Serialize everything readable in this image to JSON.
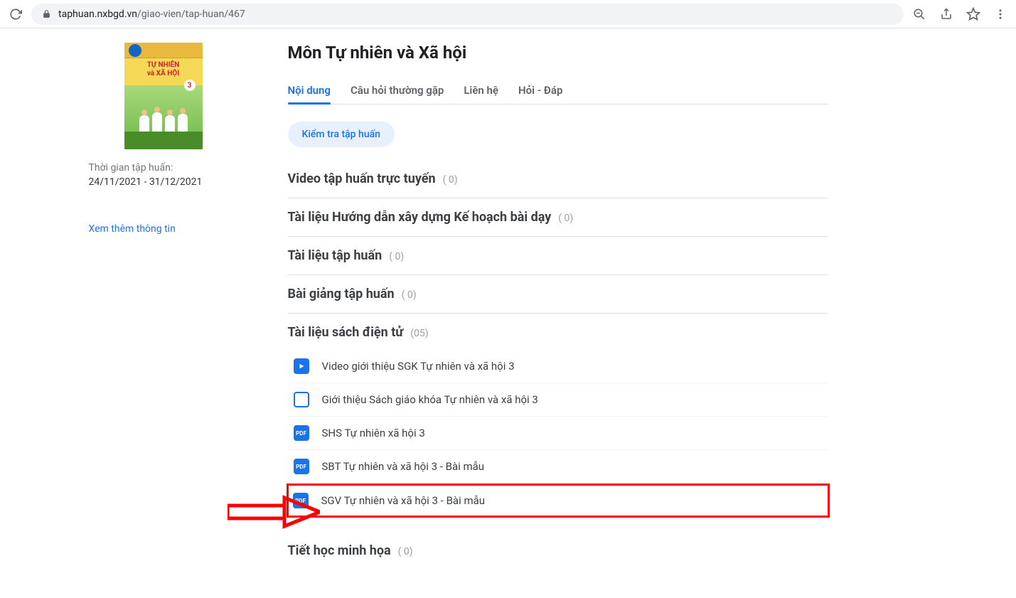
{
  "browser": {
    "url_domain": "taphuan.nxbgd.vn",
    "url_path": "/giao-vien/tap-huan/467"
  },
  "sidebar": {
    "book_title_line1": "TỰ NHIÊN",
    "book_title_line2": "và XÃ HỘI",
    "book_number": "3",
    "time_label": "Thời gian tập huấn:",
    "time_range": "24/11/2021 - 31/12/2021",
    "more_info": "Xem thêm thông tin"
  },
  "main": {
    "title": "Môn Tự nhiên và Xã hội",
    "tabs": [
      {
        "label": "Nội dung",
        "active": true
      },
      {
        "label": "Câu hỏi thường gặp",
        "active": false
      },
      {
        "label": "Liên hệ",
        "active": false
      },
      {
        "label": "Hỏi - Đáp",
        "active": false
      }
    ],
    "check_button": "Kiểm tra tập huấn",
    "sections": [
      {
        "title": "Video tập huấn trực tuyến",
        "count": "( 0)"
      },
      {
        "title": "Tài liệu Hướng dẫn xây dựng Kế hoạch bài dạy",
        "count": "( 0)"
      },
      {
        "title": "Tài liệu tập huấn",
        "count": "( 0)"
      },
      {
        "title": "Bài giảng tập huấn",
        "count": "( 0)"
      },
      {
        "title": "Tài liệu sách điện tử",
        "count": "(05)",
        "items": [
          {
            "icon": "video",
            "label": "Video giới thiệu SGK Tự nhiên và xã hội 3"
          },
          {
            "icon": "box",
            "label": "Giới thiệu Sách giáo khóa Tự nhiên và xã hội 3"
          },
          {
            "icon": "pdf",
            "label": "SHS Tự nhiên xã hội 3"
          },
          {
            "icon": "pdf",
            "label": "SBT Tự nhiên và xã hội 3 - Bài mẫu"
          },
          {
            "icon": "pdf",
            "label": "SGV Tự nhiên và xã hội 3 - Bài mẫu",
            "highlighted": true
          }
        ]
      },
      {
        "title": "Tiết học minh họa",
        "count": "( 0)"
      }
    ]
  }
}
